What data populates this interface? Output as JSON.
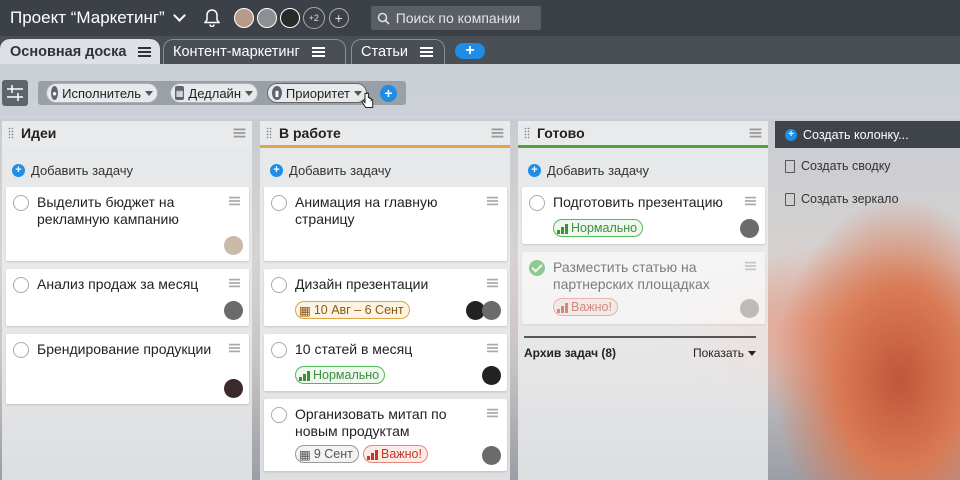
{
  "topbar": {
    "project_title": "Проект “Маркетинг”",
    "extra_members": "+2",
    "search_placeholder": "Поиск по компании"
  },
  "tabs": [
    {
      "label": "Основная доска",
      "active": true
    },
    {
      "label": "Контент-маркетинг",
      "active": false
    },
    {
      "label": "Статьи",
      "active": false
    }
  ],
  "filters": [
    {
      "label": "Исполнитель",
      "icon": "user-icon"
    },
    {
      "label": "Дедлайн",
      "icon": "calendar-icon"
    },
    {
      "label": "Приоритет",
      "icon": "priority-bars-icon"
    }
  ],
  "columns": [
    {
      "title": "Идеи",
      "accent": "#e9eaec",
      "add_task": "Добавить задачу",
      "cards": [
        {
          "title": "Выделить бюджет на рекламную кампанию"
        },
        {
          "title": "Анализ продаж за месяц"
        },
        {
          "title": "Брендирование продукции"
        }
      ]
    },
    {
      "title": "В работе",
      "accent": "#e3a447",
      "add_task": "Добавить задачу",
      "cards": [
        {
          "title": "Анимация на главную страницу"
        },
        {
          "title": "Дизайн презентации",
          "tag": "10 Авг – 6 Сент"
        },
        {
          "title": "10 статей в месяц",
          "tag": "Нормально"
        },
        {
          "title": "Организовать митап по новым продуктам",
          "tag_date": "9 Сент",
          "tag_priority": "Важно!"
        }
      ]
    },
    {
      "title": "Готово",
      "accent": "#4fa33a",
      "add_task": "Добавить задачу",
      "cards": [
        {
          "title": "Подготовить презентацию",
          "tag": "Нормально"
        },
        {
          "title": "Разместить статью на партнерских площадках",
          "tag": "Важно!",
          "done": true
        }
      ],
      "archive_label": "Архив задач (8)",
      "archive_action": "Показать"
    }
  ],
  "actions": {
    "create_column": "Создать колонку...",
    "create_summary": "Создать сводку",
    "create_mirror": "Создать зеркало"
  },
  "colors": {
    "topbar": "#3c4147",
    "accent_blue": "#1f8ce6",
    "priority_normal": "#54b857",
    "priority_important": "#e7887a",
    "deadline": "#e0a346"
  }
}
